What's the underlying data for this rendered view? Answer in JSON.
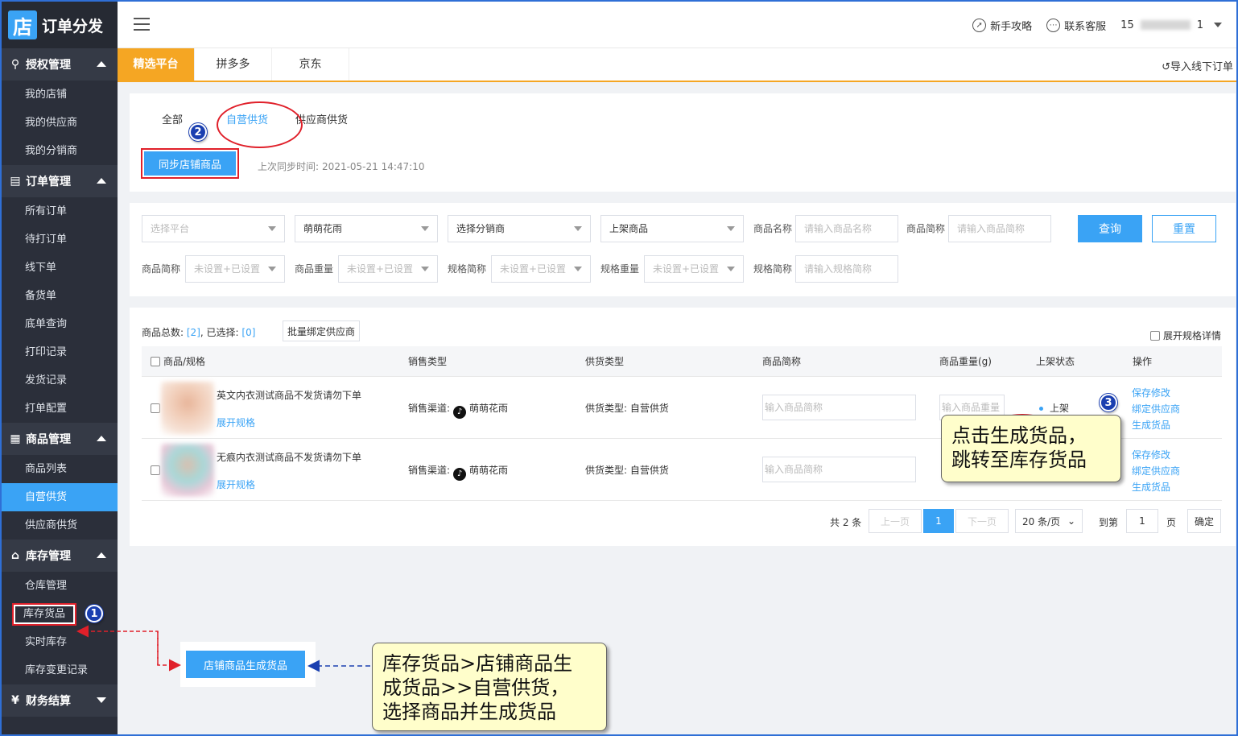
{
  "brand": {
    "logo": "店",
    "name": "订单分发"
  },
  "sidebar": {
    "groups": [
      {
        "title": "授权管理",
        "items": [
          "我的店铺",
          "我的供应商",
          "我的分销商"
        ]
      },
      {
        "title": "订单管理",
        "items": [
          "所有订单",
          "待打订单",
          "线下单",
          "备货单",
          "底单查询",
          "打印记录",
          "发货记录",
          "打单配置"
        ]
      },
      {
        "title": "商品管理",
        "items": [
          "商品列表",
          "自营供货",
          "供应商供货"
        ]
      },
      {
        "title": "库存管理",
        "items": [
          "仓库管理",
          "库存货品",
          "实时库存",
          "库存变更记录"
        ]
      },
      {
        "title": "财务结算",
        "items": []
      }
    ],
    "active_item": "自营供货"
  },
  "topbar": {
    "guide": "新手攻略",
    "support": "联系客服",
    "user_prefix": "15",
    "user_suffix": "1"
  },
  "platform_tabs": [
    "精选平台",
    "拼多多",
    "京东"
  ],
  "import_link": "导入线下订单",
  "supply_tabs": [
    "全部",
    "自营供货",
    "供应商供货"
  ],
  "sync": {
    "button": "同步店铺商品",
    "label": "上次同步时间:",
    "time": "2021-05-21 14:47:10"
  },
  "filters": {
    "platform_ph": "选择平台",
    "shop": "萌萌花雨",
    "distributor": "选择分销商",
    "listing": "上架商品",
    "name_label": "商品名称",
    "name_ph": "请输入商品名称",
    "short_label": "商品简称",
    "short_ph": "请输入商品简称",
    "query": "查询",
    "reset": "重置",
    "short2_label": "商品简称",
    "short2_ph": "未设置+已设置",
    "weight_label": "商品重量",
    "weight_ph": "未设置+已设置",
    "spec_short_label": "规格简称",
    "spec_short_ph": "未设置+已设置",
    "spec_weight_label": "规格重量",
    "spec_weight_ph": "未设置+已设置",
    "spec_abbr_label": "规格简称",
    "spec_abbr_ph": "请输入规格简称"
  },
  "table": {
    "total_label": "商品总数:",
    "total": "[2]",
    "selected_label": "已选择:",
    "selected": "[0]",
    "batch_bind": "批量绑定供应商",
    "expand_all": "展开规格详情",
    "headers": [
      "商品/规格",
      "销售类型",
      "供货类型",
      "商品简称",
      "商品重量(g)",
      "上架状态",
      "操作"
    ],
    "rows": [
      {
        "name": "英文内衣测试商品不发货请勿下单",
        "expand": "展开规格",
        "sale_label": "销售渠道:",
        "channel": "萌萌花雨",
        "supply": "供货类型: 自营供货",
        "short_ph": "输入商品简称",
        "weight_ph": "输入商品重量",
        "status": "上架",
        "ops": [
          "保存修改",
          "绑定供应商",
          "生成货品"
        ]
      },
      {
        "name": "无痕内衣测试商品不发货请勿下单",
        "expand": "展开规格",
        "sale_label": "销售渠道:",
        "channel": "萌萌花雨",
        "supply": "供货类型: 自营供货",
        "short_ph": "输入商品简称",
        "weight_ph": "",
        "status": "",
        "ops": [
          "保存修改",
          "绑定供应商",
          "生成货品"
        ]
      }
    ]
  },
  "pager": {
    "total": "共 2 条",
    "prev": "上一页",
    "current": "1",
    "next": "下一页",
    "size": "20 条/页",
    "goto": "到第",
    "page": "1",
    "page_unit": "页",
    "confirm": "确定"
  },
  "annotations": {
    "badge1": "1",
    "badge2": "2",
    "badge3": "3",
    "callout1_line1": "点击生成货品，",
    "callout1_line2": "跳转至库存货品",
    "callout2_line1": "库存货品>店铺商品生",
    "callout2_line2": "成货品>>自营供货，",
    "callout2_line3": "选择商品并生成货品",
    "gen_button": "店铺商品生成货品"
  },
  "colors": {
    "accent": "#3aa3f5",
    "orange": "#f5a623",
    "sidebar": "#2b2f3a",
    "highlight": "#e0202a",
    "callout": "#fffecb"
  }
}
